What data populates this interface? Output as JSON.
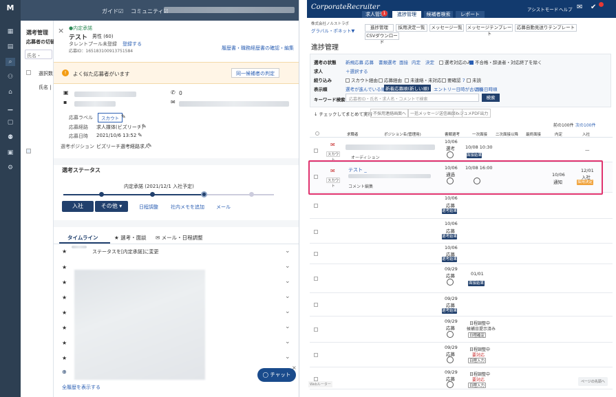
{
  "left": {
    "topbar": {
      "guide": "ガイド☑",
      "community": "コミュニティ☑"
    },
    "list": {
      "title": "選考管理",
      "subtitle": "応募者の切替",
      "search_placeholder": "氏名・",
      "col1": "選択数",
      "col2": "氏名 |"
    },
    "applicant": {
      "status": "●内定承諾",
      "name": "テスト",
      "gender_age": "男性 (60)",
      "talent_pool": "タレントプール未登録",
      "register_link": "登録する",
      "applicant_id": "応募ID：165183100913751584",
      "history_link": "履歴書・職務経歴書の確認・編集",
      "warning": "よく似た応募者がいます",
      "same_check": "同一候補者の判定",
      "phone_value": "0",
      "label_key": "応募ラベル",
      "label_tag": "スカウト",
      "route_key": "応募経路",
      "route_value": "求人媒体(ビズリーチ)",
      "date_key": "応募日時",
      "date_value": "2021/10/6 13:52",
      "position_key": "選考ポジション",
      "position_value": "ビズリーチ選考経路求人"
    },
    "selection": {
      "title": "選考ステータス",
      "step_label": "内定承諾 (2021/12/1 入社予定)",
      "join_btn": "入社",
      "other_btn": "その他 ▾",
      "schedule": "日程調整",
      "memo": "社内メモを追加",
      "mail": "メール"
    },
    "timeline": {
      "tab1": "タイムライン",
      "tab2": "★ 選考・面談",
      "tab3": "✉ メール・日程調整",
      "first_entry": "ステータスを[内定承諾]に変更",
      "show_all": "全履歴を表示する",
      "chat_btn": "◯ チャット"
    }
  },
  "right": {
    "brand": "CorporateRecruiter",
    "tabs": [
      "求人管理",
      "進捗管理",
      "候補者検索",
      "レポート"
    ],
    "badge": "1",
    "assist": "アシストモード",
    "help": "ヘルプ",
    "company": "株式会社ノルストラボ",
    "group": "グラバル・ポネット▼",
    "subnav": [
      "進捗管理",
      "採用決定一覧",
      "メッセージ一覧",
      "メッセージテンプレート",
      "応募自動見送りテンプレート",
      "CSVダウンロード"
    ],
    "page_title": "進捗管理",
    "filters": {
      "status_label": "選考の状態",
      "status_items": [
        "新規応募",
        "応募",
        "書類選考",
        "面接",
        "内定",
        "決定"
      ],
      "status_check1": "選考対応のみ",
      "status_check2": "不合格・辞退者・対応終了を除く",
      "job_label": "求人",
      "job_add": "＋選択する",
      "narrow_label": "絞り込み",
      "narrow_items": [
        "スカウト経由",
        "応募経由",
        "未連絡・未対応",
        "要確認",
        "未読"
      ],
      "narrow_count": "7",
      "display_label": "表示順",
      "display_items": [
        "選考が進んでいる順",
        "新着応募順(新しい順)",
        "エントリー日時が古い順",
        "面接日時順"
      ],
      "keyword_label": "キーワード検索",
      "keyword_placeholder": "応募者ID・氏名・求人名・コメントで検索",
      "search_btn": "検索"
    },
    "bulk": {
      "label": "↓ チェックしてまとめて実行",
      "btn1": "不採用連絡画面へ",
      "btn2": "一括メッセージ送信画面へ",
      "btn3": "レジュメPDF出力"
    },
    "pagination": {
      "range": "前の100件",
      "next": "次の100件"
    },
    "table_headers": [
      "求職者",
      "ポジション名(管理用)",
      "書類選考",
      "一次面接",
      "二次面接以降",
      "最終面接",
      "内定",
      "入社"
    ],
    "rows": [
      {
        "label": "スカウト",
        "stage_date": "10/06",
        "stage": "選考",
        "interview_date": "10/08 10:30",
        "tag": "面接結果",
        "comment": "オーディション",
        "name": "",
        "offer": "",
        "join": "—"
      },
      {
        "label": "スカウト",
        "name": "テスト _",
        "comment": "コメント編集",
        "stage_date": "10/06",
        "stage": "通過",
        "interview_date": "10/08 16:00",
        "offer_date": "10/06",
        "offer": "通知",
        "join_date": "12/01",
        "join": "入社",
        "join_tag": "採用決定"
      },
      {
        "stage_date": "10/06",
        "stage": "応募",
        "tag": "選考結果"
      },
      {
        "stage_date": "10/06",
        "stage": "応募",
        "tag": "選考結果"
      },
      {
        "stage_date": "10/06",
        "stage": "応募",
        "tag": "選考結果"
      },
      {
        "stage_date": "09/29",
        "stage": "応募",
        "interview_date": "01/01",
        "tag": "面接結果"
      },
      {
        "stage_date": "09/29",
        "stage": "応募",
        "tag": "選考結果"
      },
      {
        "stage_date": "09/29",
        "stage": "応募",
        "interview_note": "日程調整中",
        "interview_note2": "候補日提示済み",
        "tag": "日程確定"
      },
      {
        "stage_date": "09/29",
        "stage": "応募",
        "interview_note": "日程調整中",
        "interview_note2": "要対応",
        "tag": "日程入力"
      },
      {
        "stage_date": "09/29",
        "stage": "応募",
        "interview_note": "日程調整中",
        "interview_note2": "要対応",
        "tag": "日程入力"
      }
    ],
    "footer_left": "Webルーター",
    "footer_right": "ページの先頭へ"
  }
}
